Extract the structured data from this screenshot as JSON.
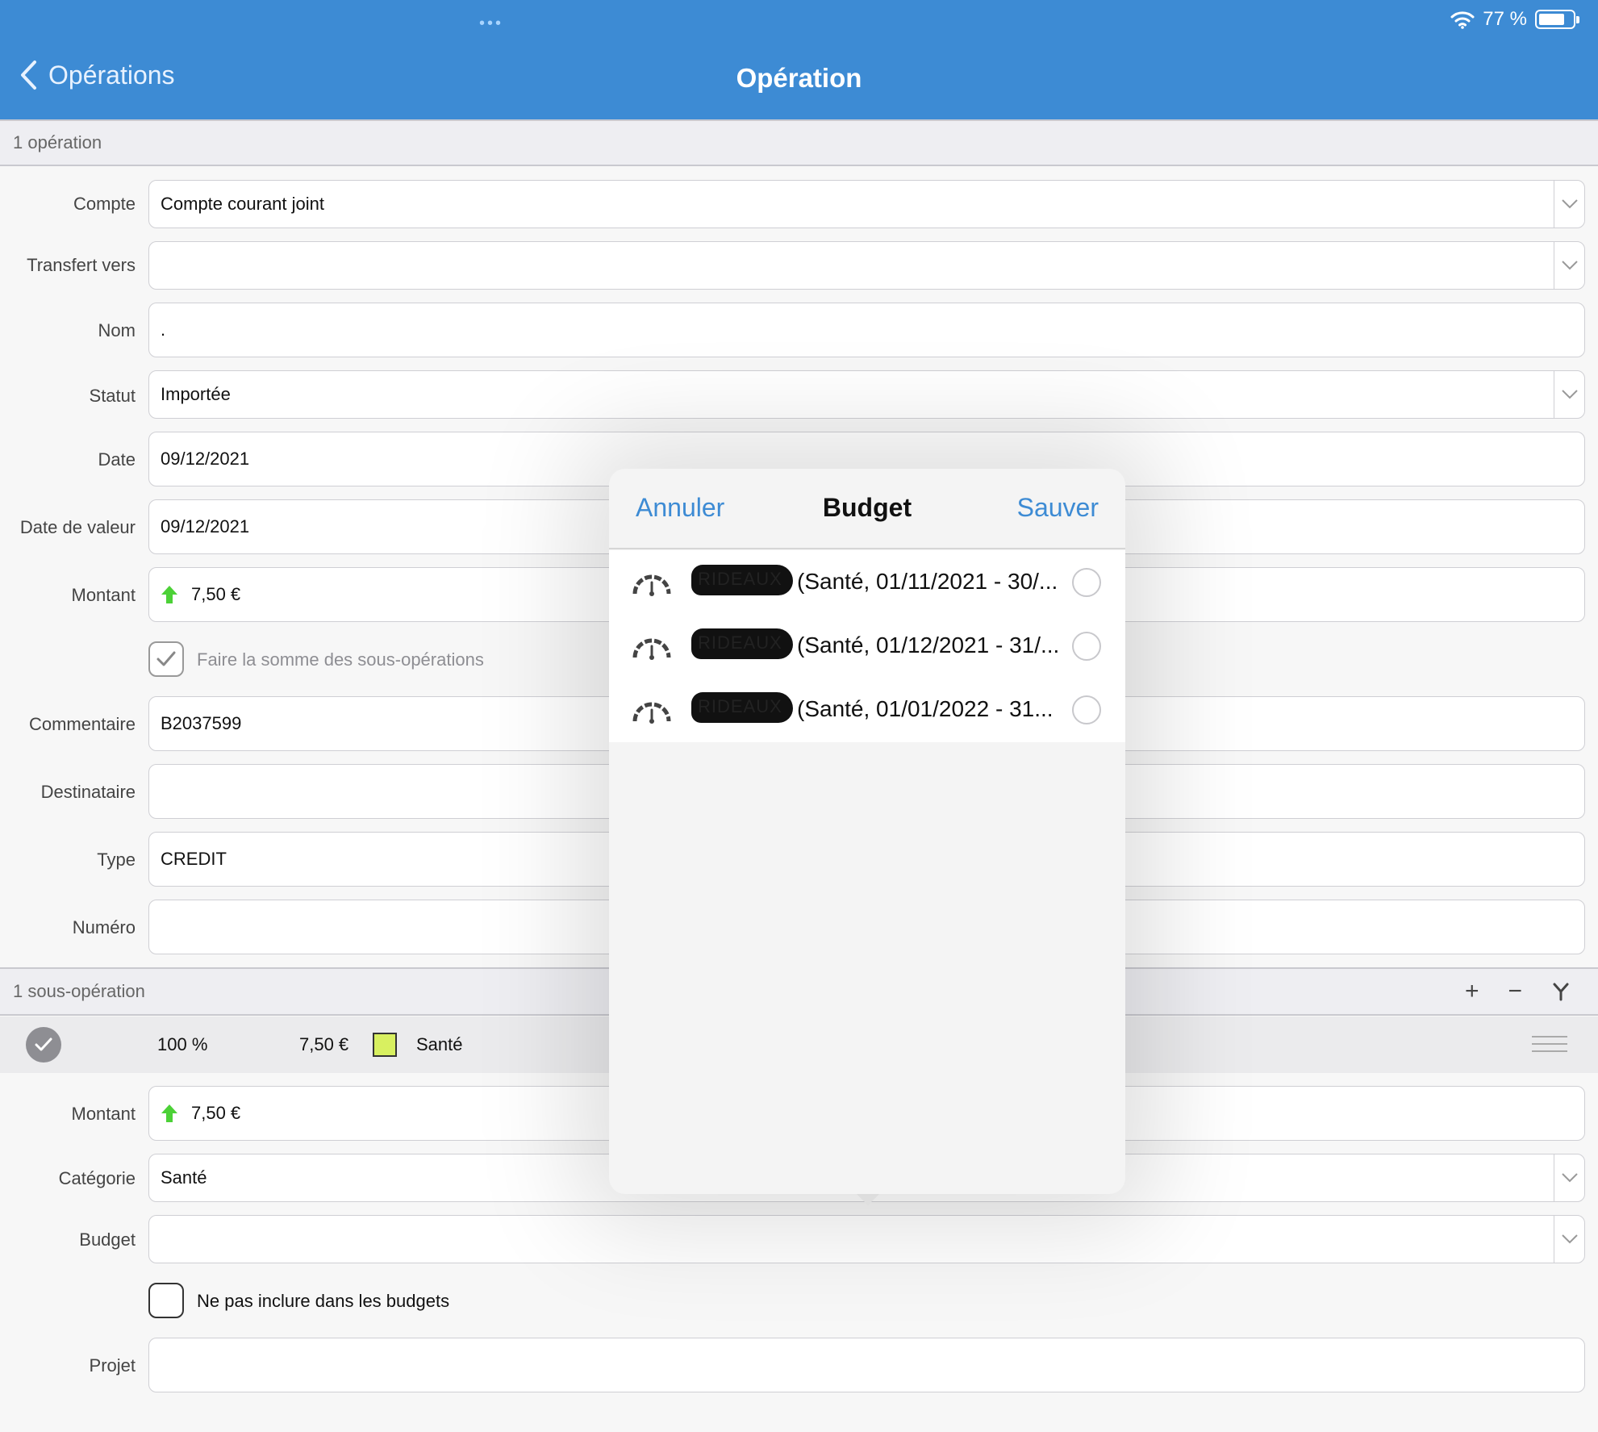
{
  "status_bar": {
    "wifi_icon": "wifi-icon",
    "battery": "77 %",
    "battery_level": 0.77,
    "multitask": "•••"
  },
  "nav": {
    "back_label": "Opérations",
    "title": "Opération"
  },
  "operation_section": {
    "label": "1 opération"
  },
  "fields": {
    "compte": {
      "label": "Compte",
      "value": "Compte courant joint"
    },
    "transfert": {
      "label": "Transfert vers",
      "value": ""
    },
    "nom": {
      "label": "Nom",
      "value": "."
    },
    "statut": {
      "label": "Statut",
      "value": "Importée"
    },
    "date": {
      "label": "Date",
      "value": "09/12/2021"
    },
    "date_valeur": {
      "label": "Date de valeur",
      "value": "09/12/2021"
    },
    "montant": {
      "label": "Montant",
      "value": "7,50 €"
    },
    "somme": {
      "label": "Faire la somme des sous-opérations",
      "checked": true
    },
    "commentaire": {
      "label": "Commentaire",
      "value": "B2037599"
    },
    "destinataire": {
      "label": "Destinataire",
      "value": ""
    },
    "type": {
      "label": "Type",
      "value": "CREDIT"
    },
    "numero": {
      "label": "Numéro",
      "value": ""
    }
  },
  "sub_section": {
    "label": "1 sous-opération",
    "tools": [
      "+",
      "−",
      "Y"
    ]
  },
  "sub_row": {
    "percent": "100 %",
    "amount": "7,50 €",
    "category": "Santé",
    "swatch_color": "#d8f060"
  },
  "sub_fields": {
    "montant": {
      "label": "Montant",
      "value": "7,50 €"
    },
    "categorie": {
      "label": "Catégorie",
      "value": "Santé"
    },
    "budget": {
      "label": "Budget",
      "value": ""
    },
    "exclure": {
      "label": "Ne pas inclure dans les budgets",
      "checked": false
    },
    "projet": {
      "label": "Projet",
      "value": ""
    }
  },
  "popover": {
    "cancel": "Annuler",
    "title": "Budget",
    "save": "Sauver",
    "items": [
      {
        "redacted": "RIDEAUX",
        "text": "(Santé, 01/11/2021 - 30/...",
        "selected": false
      },
      {
        "redacted": "RIDEAUX",
        "text": "(Santé, 01/12/2021 - 31/...",
        "selected": false
      },
      {
        "redacted": "RIDEAUX",
        "text": "(Santé, 01/01/2022 - 31...",
        "selected": false
      }
    ]
  },
  "colors": {
    "accent": "#3d8bd4",
    "arrow_green": "#4cd137"
  }
}
